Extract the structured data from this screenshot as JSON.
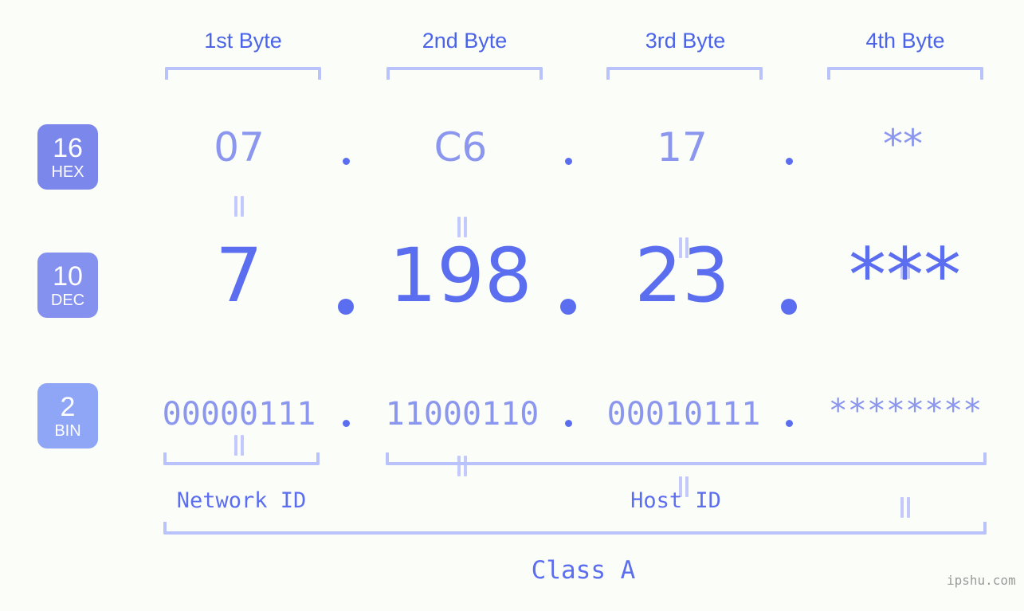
{
  "background_color": "#fbfdf8",
  "colors": {
    "byte_label": "#4a63e8",
    "bracket": "#b9c2fa",
    "hex_value": "#8b97ee",
    "dec_value": "#5c6ef0",
    "bin_value": "#8b97ee",
    "badge_hex": "#7b87ea",
    "badge_dec": "#8591ee",
    "badge_bin": "#8fa5f5",
    "connector": "#c3cafb",
    "watermark": "#9b9b9b"
  },
  "byte_headers": [
    {
      "label": "1st Byte"
    },
    {
      "label": "2nd Byte"
    },
    {
      "label": "3rd Byte"
    },
    {
      "label": "4th Byte"
    }
  ],
  "rows": [
    {
      "badge": {
        "base": "16",
        "name": "HEX"
      },
      "values": [
        "07",
        "C6",
        "17",
        "**"
      ],
      "separator": "."
    },
    {
      "badge": {
        "base": "10",
        "name": "DEC"
      },
      "values": [
        "7",
        "198",
        "23",
        "***"
      ],
      "separator": "."
    },
    {
      "badge": {
        "base": "2",
        "name": "BIN"
      },
      "values": [
        "00000111",
        "11000110",
        "00010111",
        "********"
      ],
      "separator": "."
    }
  ],
  "connector_symbol": "=",
  "footer": {
    "network_id_label": "Network ID",
    "host_id_label": "Host ID",
    "class_label": "Class A",
    "watermark": "ipshu.com"
  }
}
